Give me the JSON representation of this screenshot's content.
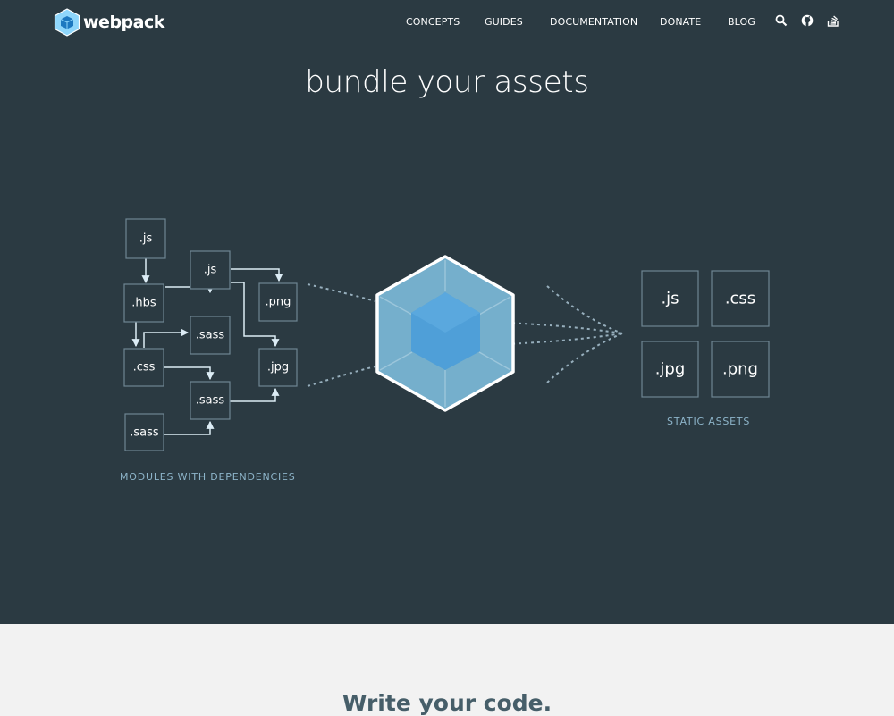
{
  "header": {
    "brand": "webpack",
    "nav": [
      {
        "label": "CONCEPTS"
      },
      {
        "label": "GUIDES"
      },
      {
        "label": "DOCUMENTATION"
      },
      {
        "label": "DONATE"
      },
      {
        "label": "BLOG"
      }
    ],
    "icons": [
      "search-icon",
      "github-icon",
      "stackoverflow-icon"
    ]
  },
  "hero": {
    "title": "bundle your assets",
    "modules": [
      ".js",
      ".js",
      ".hbs",
      ".png",
      ".sass",
      ".css",
      ".jpg",
      ".sass",
      ".sass"
    ],
    "modules_caption": "MODULES WITH DEPENDENCIES",
    "assets": [
      ".js",
      ".css",
      ".jpg",
      ".png"
    ],
    "assets_caption": "STATIC ASSETS"
  },
  "section": {
    "title": "Write your code."
  },
  "colors": {
    "hero_background": "#2b3a42",
    "accent": "#8db4c9",
    "cube_outer": "#75afcc",
    "cube_inner": "#4f9fd8",
    "section_background": "#f2f2f2",
    "section_title": "#465e69"
  }
}
